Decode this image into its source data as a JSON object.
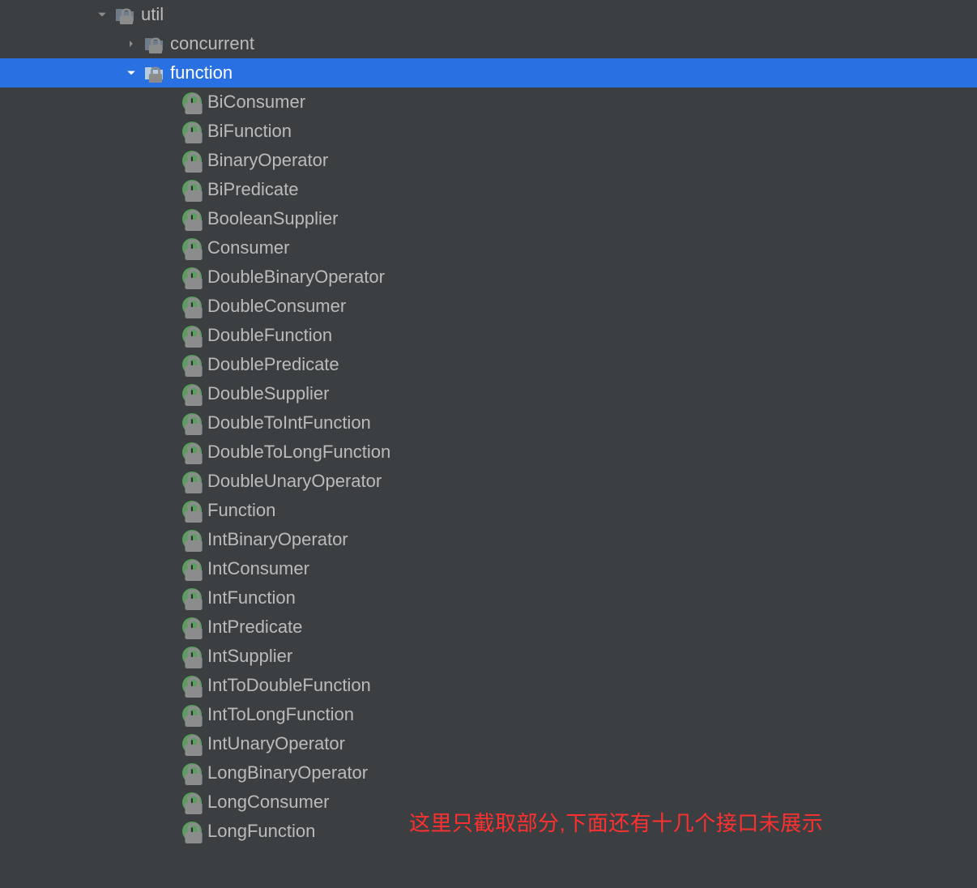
{
  "tree": {
    "util": {
      "label": "util",
      "expanded": true,
      "children": {
        "concurrent": {
          "label": "concurrent",
          "expanded": false
        },
        "function": {
          "label": "function",
          "expanded": true,
          "selected": true,
          "items": [
            "BiConsumer",
            "BiFunction",
            "BinaryOperator",
            "BiPredicate",
            "BooleanSupplier",
            "Consumer",
            "DoubleBinaryOperator",
            "DoubleConsumer",
            "DoubleFunction",
            "DoublePredicate",
            "DoubleSupplier",
            "DoubleToIntFunction",
            "DoubleToLongFunction",
            "DoubleUnaryOperator",
            "Function",
            "IntBinaryOperator",
            "IntConsumer",
            "IntFunction",
            "IntPredicate",
            "IntSupplier",
            "IntToDoubleFunction",
            "IntToLongFunction",
            "IntUnaryOperator",
            "LongBinaryOperator",
            "LongConsumer",
            "LongFunction"
          ]
        }
      }
    }
  },
  "annotation": "这里只截取部分,下面还有十几个接口未展示",
  "colors": {
    "background": "#3c3f41",
    "selection": "#2970e3",
    "text": "#bbbbbb",
    "selectedText": "#ffffff",
    "interfaceIcon": "#5b9e5e",
    "annotation": "#ff3030"
  }
}
